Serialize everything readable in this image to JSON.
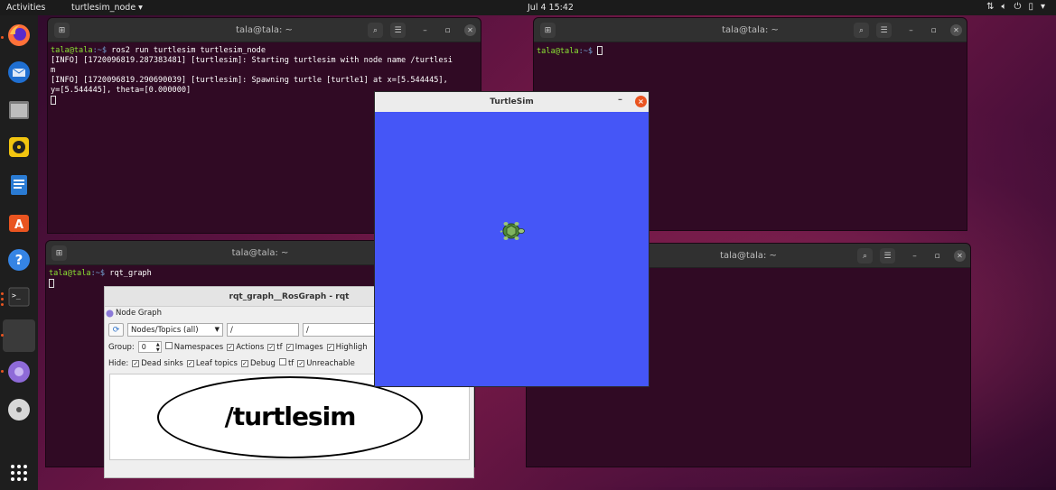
{
  "topbar": {
    "activities": "Activities",
    "app_menu": "turtlesim_node ▾",
    "clock": "Jul 4  15:42"
  },
  "dock": {
    "items": [
      "firefox-icon",
      "thunderbird-icon",
      "files-icon",
      "rhythmbox-icon",
      "writer-icon",
      "software-icon",
      "help-icon",
      "terminal-icon",
      "rqt-icon",
      "turtle-app-icon",
      "disc-icon",
      "app-grid-icon"
    ]
  },
  "terminal1": {
    "title": "tala@tala: ~",
    "prompt_user": "tala@tala",
    "prompt_path": ":~$",
    "command": " ros2 run turtlesim turtlesim_node",
    "line2": "[INFO] [1720096819.287383481] [turtlesim]: Starting turtlesim with node name /turtlesi",
    "line3": "m",
    "line4": "[INFO] [1720096819.290690039] [turtlesim]: Spawning turtle [turtle1] at x=[5.544445],",
    "line5": "y=[5.544445], theta=[0.000000]"
  },
  "terminal2": {
    "title": "tala@tala: ~",
    "prompt_user": "tala@tala",
    "prompt_path": ":~$"
  },
  "terminal3": {
    "title": "tala@tala: ~",
    "prompt_user": "tala@tala",
    "prompt_path": ":~$",
    "command": " rqt_graph"
  },
  "terminal4": {
    "title": "tala@tala: ~"
  },
  "turtlesim": {
    "title": "TurtleSim",
    "minimize": "–",
    "close": "×",
    "bg_color": "#4556f7"
  },
  "rqt": {
    "title": "rqt_graph__RosGraph - rqt",
    "plugin": "Node Graph",
    "mode": "Nodes/Topics (all)",
    "filter1": "/",
    "filter2": "/",
    "group_label": "Group:",
    "group_value": "0",
    "namespaces": "Namespaces",
    "actions": "Actions",
    "tf": "tf",
    "images": "Images",
    "highlight": "Highligh",
    "hide_label": "Hide:",
    "dead_sinks": "Dead sinks",
    "leaf_topics": "Leaf topics",
    "debug": "Debug",
    "tf2": "tf",
    "unreachable": "Unreachable",
    "node": "/turtlesim"
  }
}
